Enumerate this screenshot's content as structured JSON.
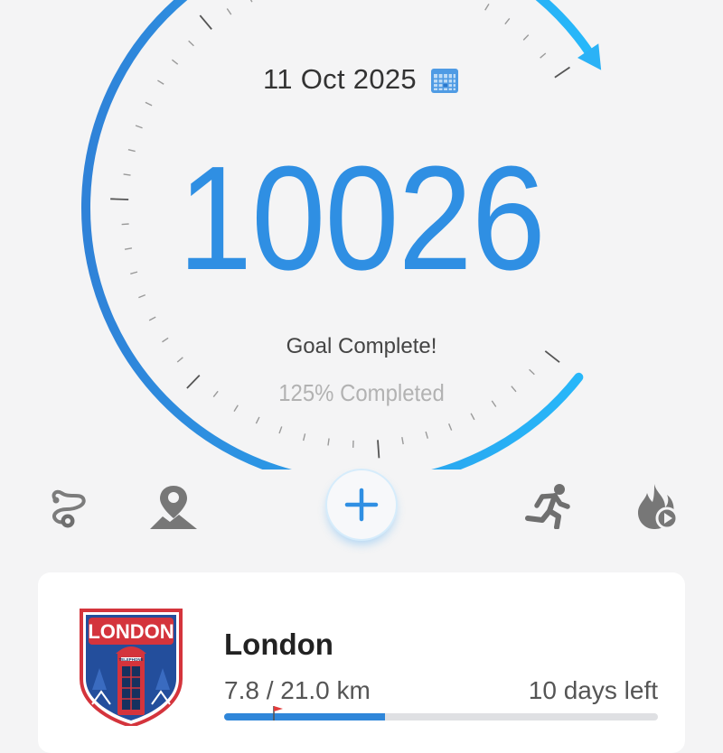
{
  "dial": {
    "date": "11 Oct 2025",
    "steps": "10026",
    "goal_text": "Goal Complete!",
    "percent_text": "125% Completed",
    "progress_fraction": 1.25
  },
  "actions": [
    {
      "name": "route-icon"
    },
    {
      "name": "map-pin-icon"
    },
    {
      "name": "add-icon"
    },
    {
      "name": "running-icon"
    },
    {
      "name": "calories-icon"
    }
  ],
  "challenge": {
    "name": "London",
    "progress_text": "7.8 / 21.0 km",
    "days_left": "10 days left",
    "progress_fraction": 0.371,
    "badge_label": "LONDON",
    "badge_sign": "TELEPHONE"
  },
  "colors": {
    "accent": "#2f8fe3",
    "accent_light": "#28b4f8",
    "card": "#ffffff",
    "background": "#f4f4f5"
  }
}
